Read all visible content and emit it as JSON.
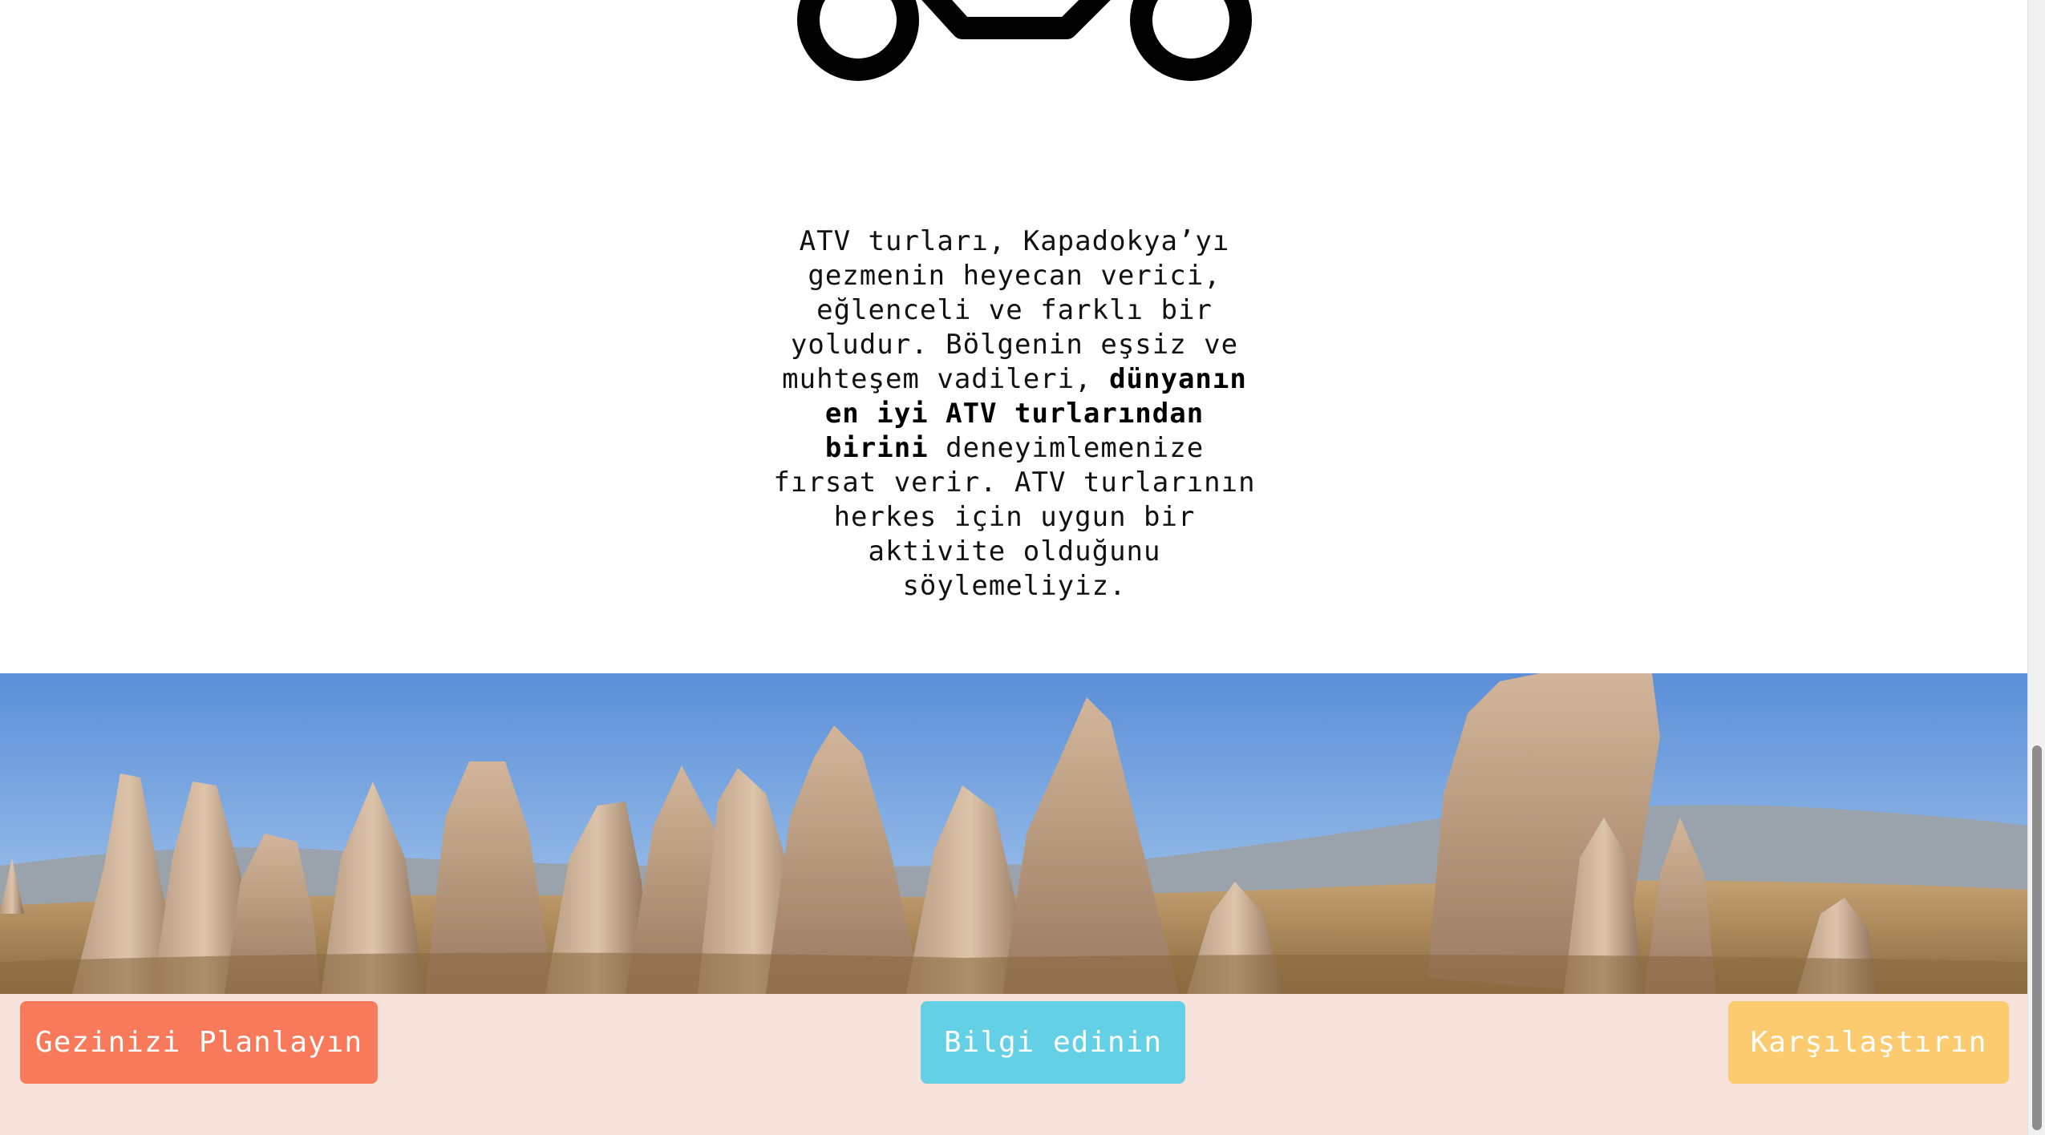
{
  "intro": {
    "text_before": "ATV turları, Kapadokya’yı gezmenin heyecan verici, eğlenceli ve farklı bir yoludur. Bölgenin eşsiz ve muhteşem vadileri, ",
    "text_bold": "dünyanın en iyi ATV turlarından birini",
    "text_after": " deneyimlemenize fırsat verir. ATV turlarının herkes için uygun bir aktivite olduğunu söylemeliyiz."
  },
  "icons": {
    "atv": "atv-icon"
  },
  "buttons": {
    "plan": "Gezinizi Planlayın",
    "info": "Bilgi edinin",
    "compare": "Karşılaştırın"
  },
  "colors": {
    "plan_button": "#f87a5a",
    "info_button": "#63d0e6",
    "compare_button": "#fcca6f",
    "footer_background": "#f7e3dc"
  }
}
